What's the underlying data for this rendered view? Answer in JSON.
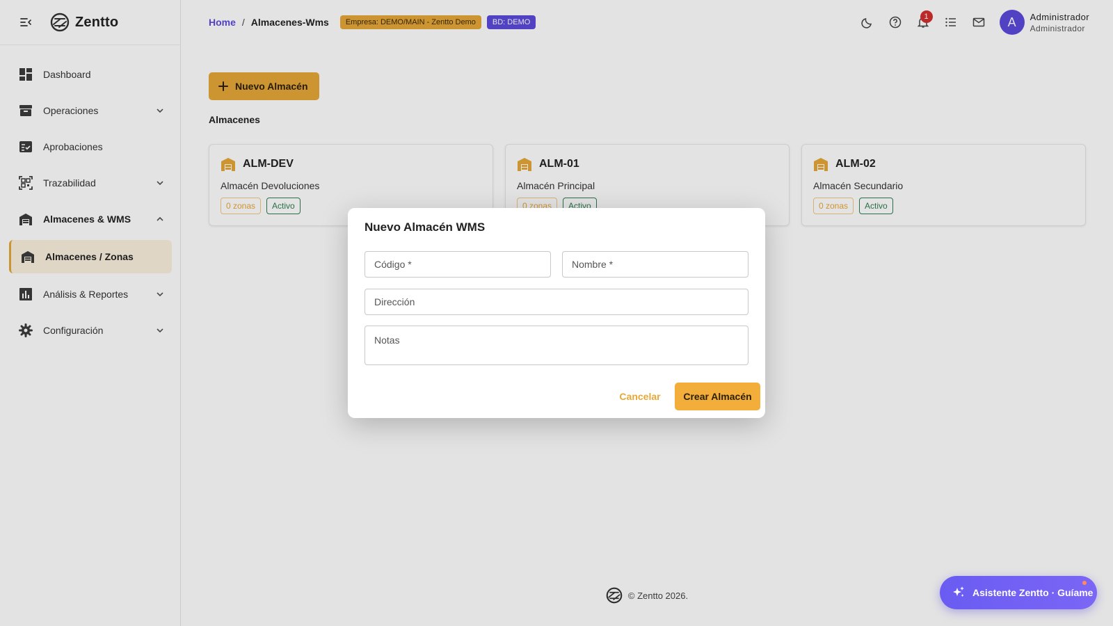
{
  "app": {
    "name": "Zentto"
  },
  "sidebar": {
    "items": [
      {
        "label": "Dashboard"
      },
      {
        "label": "Operaciones"
      },
      {
        "label": "Aprobaciones"
      },
      {
        "label": "Trazabilidad"
      },
      {
        "label": "Almacenes & WMS"
      },
      {
        "label": "Almacenes / Zonas"
      },
      {
        "label": "Análisis & Reportes"
      },
      {
        "label": "Configuración"
      }
    ]
  },
  "header": {
    "breadcrumb": {
      "home": "Home",
      "separator": "/",
      "current": "Almacenes-Wms"
    },
    "empresa_badge": "Empresa: DEMO/MAIN - Zentto Demo",
    "bd_badge": "BD: DEMO",
    "notifications_count": "1",
    "user": {
      "initial": "A",
      "name": "Administrador",
      "role": "Administrador"
    }
  },
  "main": {
    "new_button": "Nuevo Almacén",
    "section_title": "Almacenes",
    "cards": [
      {
        "code": "ALM-DEV",
        "name": "Almacén Devoluciones",
        "zonas": "0 zonas",
        "status": "Activo"
      },
      {
        "code": "ALM-01",
        "name": "Almacén Principal",
        "zonas": "0 zonas",
        "status": "Activo"
      },
      {
        "code": "ALM-02",
        "name": "Almacén Secundario",
        "zonas": "0 zonas",
        "status": "Activo"
      }
    ]
  },
  "dialog": {
    "title": "Nuevo Almacén WMS",
    "fields": {
      "codigo": {
        "placeholder": "Código *",
        "value": ""
      },
      "nombre": {
        "placeholder": "Nombre *",
        "value": ""
      },
      "direccion": {
        "placeholder": "Dirección",
        "value": ""
      },
      "notas": {
        "placeholder": "Notas",
        "value": ""
      }
    },
    "cancel": "Cancelar",
    "submit": "Crear Almacén"
  },
  "footer": {
    "text": "© Zentto 2026."
  },
  "assistant": {
    "label": "Asistente Zentto · Guíame"
  },
  "colors": {
    "accent": "#e7a838",
    "brand": "#5b4bdc",
    "success": "#2e7d4f",
    "danger": "#d32f2f"
  },
  "icons": {
    "menu_toggle": "menu-collapse-icon",
    "theme": "moon-icon",
    "help": "help-circle-icon",
    "notifications": "bell-icon",
    "tasks": "list-icon",
    "mail": "mail-icon",
    "add": "plus-icon",
    "warehouse": "warehouse-icon",
    "assistant": "sparkles-icon"
  }
}
